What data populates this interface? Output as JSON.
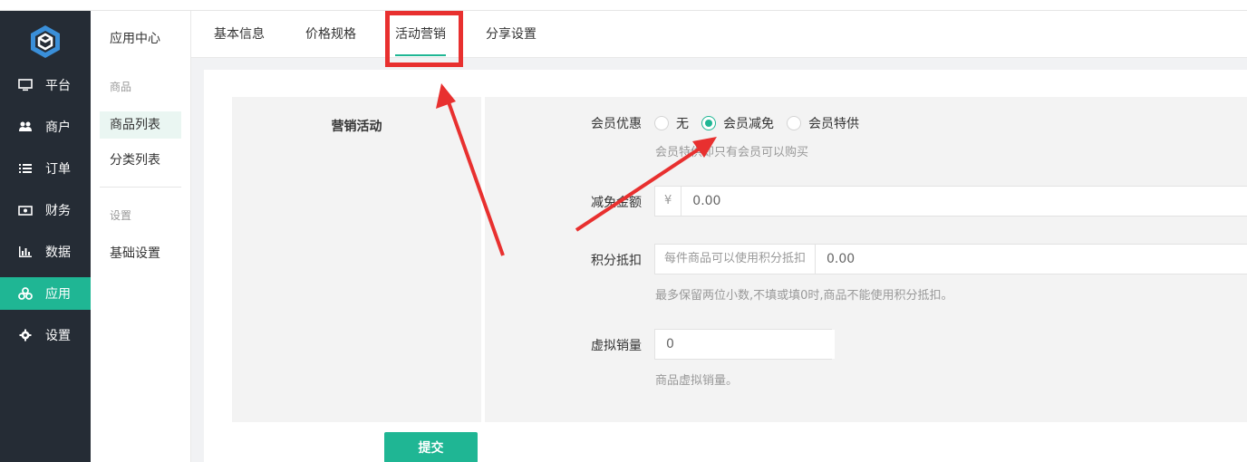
{
  "nav": {
    "items": [
      {
        "label": "平台",
        "icon": "monitor-icon"
      },
      {
        "label": "商户",
        "icon": "users-icon"
      },
      {
        "label": "订单",
        "icon": "list-icon"
      },
      {
        "label": "财务",
        "icon": "money-icon"
      },
      {
        "label": "数据",
        "icon": "bar-chart-icon"
      },
      {
        "label": "应用",
        "icon": "apps-icon",
        "active": true
      },
      {
        "label": "设置",
        "icon": "gear-icon"
      }
    ],
    "accent": "#1fb694",
    "background": "#252c35"
  },
  "subnav": {
    "title": "应用中心",
    "section1": "商品",
    "item_goods_list": "商品列表",
    "item_category_list": "分类列表",
    "section2": "设置",
    "item_basic_settings": "基础设置"
  },
  "tabs": [
    "基本信息",
    "价格规格",
    "活动营销",
    "分享设置"
  ],
  "active_tab": "活动营销",
  "form": {
    "section_title": "营销活动",
    "member_discount": {
      "label": "会员优惠",
      "options": [
        "无",
        "会员减免",
        "会员特供"
      ],
      "selected": "会员减免",
      "help": "会员特供即只有会员可以购买"
    },
    "reduce_amount": {
      "label": "减免金额",
      "prefix": "¥",
      "value": "0.00"
    },
    "points_deduct": {
      "label": "积分抵扣",
      "prefix": "每件商品可以使用积分抵扣",
      "value": "0.00",
      "help": "最多保留两位小数,不填或填0时,商品不能使用积分抵扣。"
    },
    "virtual_sales": {
      "label": "虚拟销量",
      "value": "0",
      "help": "商品虚拟销量。"
    },
    "submit_label": "提交"
  },
  "annotation_color": "#e8302f"
}
